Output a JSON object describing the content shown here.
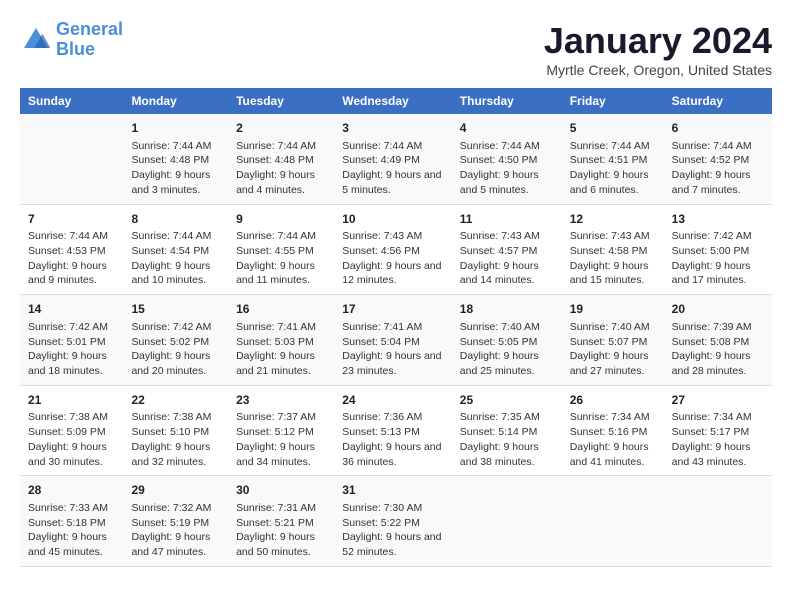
{
  "logo": {
    "line1": "General",
    "line2": "Blue"
  },
  "title": "January 2024",
  "subtitle": "Myrtle Creek, Oregon, United States",
  "headers": [
    "Sunday",
    "Monday",
    "Tuesday",
    "Wednesday",
    "Thursday",
    "Friday",
    "Saturday"
  ],
  "weeks": [
    [
      {
        "day": "",
        "sunrise": "",
        "sunset": "",
        "daylight": ""
      },
      {
        "day": "1",
        "sunrise": "Sunrise: 7:44 AM",
        "sunset": "Sunset: 4:48 PM",
        "daylight": "Daylight: 9 hours and 3 minutes."
      },
      {
        "day": "2",
        "sunrise": "Sunrise: 7:44 AM",
        "sunset": "Sunset: 4:48 PM",
        "daylight": "Daylight: 9 hours and 4 minutes."
      },
      {
        "day": "3",
        "sunrise": "Sunrise: 7:44 AM",
        "sunset": "Sunset: 4:49 PM",
        "daylight": "Daylight: 9 hours and 5 minutes."
      },
      {
        "day": "4",
        "sunrise": "Sunrise: 7:44 AM",
        "sunset": "Sunset: 4:50 PM",
        "daylight": "Daylight: 9 hours and 5 minutes."
      },
      {
        "day": "5",
        "sunrise": "Sunrise: 7:44 AM",
        "sunset": "Sunset: 4:51 PM",
        "daylight": "Daylight: 9 hours and 6 minutes."
      },
      {
        "day": "6",
        "sunrise": "Sunrise: 7:44 AM",
        "sunset": "Sunset: 4:52 PM",
        "daylight": "Daylight: 9 hours and 7 minutes."
      }
    ],
    [
      {
        "day": "7",
        "sunrise": "Sunrise: 7:44 AM",
        "sunset": "Sunset: 4:53 PM",
        "daylight": "Daylight: 9 hours and 9 minutes."
      },
      {
        "day": "8",
        "sunrise": "Sunrise: 7:44 AM",
        "sunset": "Sunset: 4:54 PM",
        "daylight": "Daylight: 9 hours and 10 minutes."
      },
      {
        "day": "9",
        "sunrise": "Sunrise: 7:44 AM",
        "sunset": "Sunset: 4:55 PM",
        "daylight": "Daylight: 9 hours and 11 minutes."
      },
      {
        "day": "10",
        "sunrise": "Sunrise: 7:43 AM",
        "sunset": "Sunset: 4:56 PM",
        "daylight": "Daylight: 9 hours and 12 minutes."
      },
      {
        "day": "11",
        "sunrise": "Sunrise: 7:43 AM",
        "sunset": "Sunset: 4:57 PM",
        "daylight": "Daylight: 9 hours and 14 minutes."
      },
      {
        "day": "12",
        "sunrise": "Sunrise: 7:43 AM",
        "sunset": "Sunset: 4:58 PM",
        "daylight": "Daylight: 9 hours and 15 minutes."
      },
      {
        "day": "13",
        "sunrise": "Sunrise: 7:42 AM",
        "sunset": "Sunset: 5:00 PM",
        "daylight": "Daylight: 9 hours and 17 minutes."
      }
    ],
    [
      {
        "day": "14",
        "sunrise": "Sunrise: 7:42 AM",
        "sunset": "Sunset: 5:01 PM",
        "daylight": "Daylight: 9 hours and 18 minutes."
      },
      {
        "day": "15",
        "sunrise": "Sunrise: 7:42 AM",
        "sunset": "Sunset: 5:02 PM",
        "daylight": "Daylight: 9 hours and 20 minutes."
      },
      {
        "day": "16",
        "sunrise": "Sunrise: 7:41 AM",
        "sunset": "Sunset: 5:03 PM",
        "daylight": "Daylight: 9 hours and 21 minutes."
      },
      {
        "day": "17",
        "sunrise": "Sunrise: 7:41 AM",
        "sunset": "Sunset: 5:04 PM",
        "daylight": "Daylight: 9 hours and 23 minutes."
      },
      {
        "day": "18",
        "sunrise": "Sunrise: 7:40 AM",
        "sunset": "Sunset: 5:05 PM",
        "daylight": "Daylight: 9 hours and 25 minutes."
      },
      {
        "day": "19",
        "sunrise": "Sunrise: 7:40 AM",
        "sunset": "Sunset: 5:07 PM",
        "daylight": "Daylight: 9 hours and 27 minutes."
      },
      {
        "day": "20",
        "sunrise": "Sunrise: 7:39 AM",
        "sunset": "Sunset: 5:08 PM",
        "daylight": "Daylight: 9 hours and 28 minutes."
      }
    ],
    [
      {
        "day": "21",
        "sunrise": "Sunrise: 7:38 AM",
        "sunset": "Sunset: 5:09 PM",
        "daylight": "Daylight: 9 hours and 30 minutes."
      },
      {
        "day": "22",
        "sunrise": "Sunrise: 7:38 AM",
        "sunset": "Sunset: 5:10 PM",
        "daylight": "Daylight: 9 hours and 32 minutes."
      },
      {
        "day": "23",
        "sunrise": "Sunrise: 7:37 AM",
        "sunset": "Sunset: 5:12 PM",
        "daylight": "Daylight: 9 hours and 34 minutes."
      },
      {
        "day": "24",
        "sunrise": "Sunrise: 7:36 AM",
        "sunset": "Sunset: 5:13 PM",
        "daylight": "Daylight: 9 hours and 36 minutes."
      },
      {
        "day": "25",
        "sunrise": "Sunrise: 7:35 AM",
        "sunset": "Sunset: 5:14 PM",
        "daylight": "Daylight: 9 hours and 38 minutes."
      },
      {
        "day": "26",
        "sunrise": "Sunrise: 7:34 AM",
        "sunset": "Sunset: 5:16 PM",
        "daylight": "Daylight: 9 hours and 41 minutes."
      },
      {
        "day": "27",
        "sunrise": "Sunrise: 7:34 AM",
        "sunset": "Sunset: 5:17 PM",
        "daylight": "Daylight: 9 hours and 43 minutes."
      }
    ],
    [
      {
        "day": "28",
        "sunrise": "Sunrise: 7:33 AM",
        "sunset": "Sunset: 5:18 PM",
        "daylight": "Daylight: 9 hours and 45 minutes."
      },
      {
        "day": "29",
        "sunrise": "Sunrise: 7:32 AM",
        "sunset": "Sunset: 5:19 PM",
        "daylight": "Daylight: 9 hours and 47 minutes."
      },
      {
        "day": "30",
        "sunrise": "Sunrise: 7:31 AM",
        "sunset": "Sunset: 5:21 PM",
        "daylight": "Daylight: 9 hours and 50 minutes."
      },
      {
        "day": "31",
        "sunrise": "Sunrise: 7:30 AM",
        "sunset": "Sunset: 5:22 PM",
        "daylight": "Daylight: 9 hours and 52 minutes."
      },
      {
        "day": "",
        "sunrise": "",
        "sunset": "",
        "daylight": ""
      },
      {
        "day": "",
        "sunrise": "",
        "sunset": "",
        "daylight": ""
      },
      {
        "day": "",
        "sunrise": "",
        "sunset": "",
        "daylight": ""
      }
    ]
  ]
}
